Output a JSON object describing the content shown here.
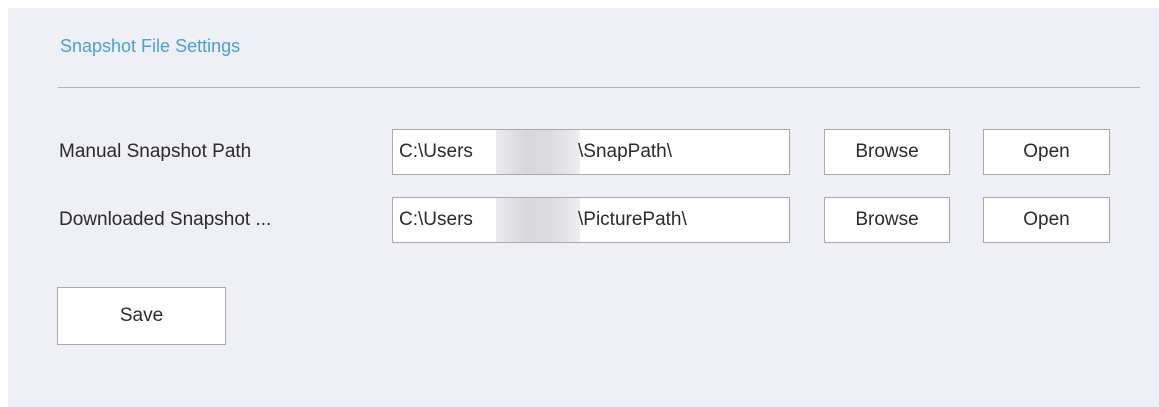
{
  "section": {
    "title": "Snapshot File Settings"
  },
  "manual_snapshot": {
    "label": "Manual Snapshot Path",
    "path_prefix": "C:\\Users",
    "path_suffix": "\\SnapPath\\",
    "browse_label": "Browse",
    "open_label": "Open"
  },
  "downloaded_snapshot": {
    "label": "Downloaded Snapshot ...",
    "path_prefix": "C:\\Users",
    "path_suffix": "\\PicturePath\\",
    "browse_label": "Browse",
    "open_label": "Open"
  },
  "actions": {
    "save_label": "Save"
  },
  "colors": {
    "panel_background": "#eff0f5",
    "title_accent": "#4a9fd8",
    "border": "#a9a9ad",
    "text": "#2b2b2b"
  }
}
